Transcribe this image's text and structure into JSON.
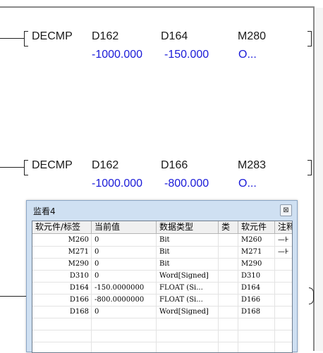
{
  "ladder": {
    "rungs": [
      {
        "instruction": "DECMP",
        "op1": "D162",
        "op2": "D164",
        "op3": "M280",
        "val1": "-1000.000",
        "val2": "-150.000",
        "val3": "O..."
      },
      {
        "instruction": "DECMP",
        "op1": "D162",
        "op2": "D166",
        "op3": "M283",
        "val1": "-1000.000",
        "val2": "-800.000",
        "val3": "O..."
      }
    ],
    "value_color": "#1a1ad8"
  },
  "watch_window": {
    "title": "监看4",
    "close_glyph": "⊠",
    "columns": [
      "软元件/标签",
      "当前值",
      "数据类型",
      "类",
      "软元件",
      "注释"
    ],
    "rows": [
      {
        "label": "M260",
        "value": "0",
        "type": "Bit",
        "cls": "",
        "device": "M260",
        "note": "—⊦"
      },
      {
        "label": "M271",
        "value": "0",
        "type": "Bit",
        "cls": "",
        "device": "M271",
        "note": "—⊦"
      },
      {
        "label": "M290",
        "value": "0",
        "type": "Bit",
        "cls": "",
        "device": "M290",
        "note": ""
      },
      {
        "label": "D310",
        "value": "0",
        "type": "Word[Signed]",
        "cls": "",
        "device": "D310",
        "note": ""
      },
      {
        "label": "D164",
        "value": "-150.0000000",
        "type": "FLOAT (Si...",
        "cls": "",
        "device": "D164",
        "note": ""
      },
      {
        "label": "D166",
        "value": "-800.0000000",
        "type": "FLOAT (Si...",
        "cls": "",
        "device": "D166",
        "note": ""
      },
      {
        "label": "D168",
        "value": "0",
        "type": "Word[Signed]",
        "cls": "",
        "device": "D168",
        "note": ""
      }
    ]
  }
}
